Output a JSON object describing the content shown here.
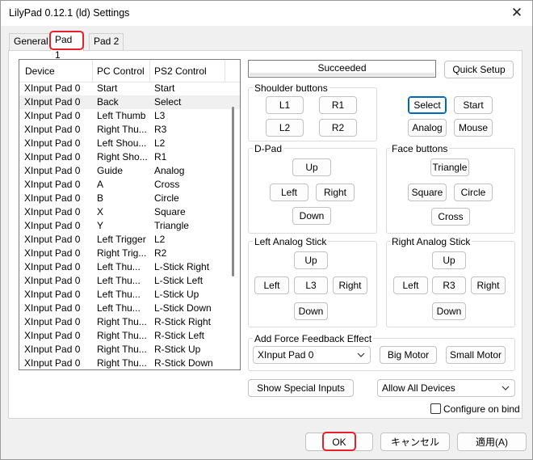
{
  "window": {
    "title": "LilyPad 0.12.1 (ld) Settings",
    "close_glyph": "✕"
  },
  "tabs": [
    {
      "label": "General"
    },
    {
      "label": "Pad 1"
    },
    {
      "label": "Pad 2"
    }
  ],
  "list": {
    "headers": [
      "Device",
      "PC Control",
      "PS2 Control"
    ],
    "rows": [
      [
        "XInput Pad 0",
        "Start",
        "Start"
      ],
      [
        "XInput Pad 0",
        "Back",
        "Select"
      ],
      [
        "XInput Pad 0",
        "Left Thumb",
        "L3"
      ],
      [
        "XInput Pad 0",
        "Right Thu...",
        "R3"
      ],
      [
        "XInput Pad 0",
        "Left Shou...",
        "L2"
      ],
      [
        "XInput Pad 0",
        "Right Sho...",
        "R1"
      ],
      [
        "XInput Pad 0",
        "Guide",
        "Analog"
      ],
      [
        "XInput Pad 0",
        "A",
        "Cross"
      ],
      [
        "XInput Pad 0",
        "B",
        "Circle"
      ],
      [
        "XInput Pad 0",
        "X",
        "Square"
      ],
      [
        "XInput Pad 0",
        "Y",
        "Triangle"
      ],
      [
        "XInput Pad 0",
        "Left Trigger",
        "L2"
      ],
      [
        "XInput Pad 0",
        "Right Trig...",
        "R2"
      ],
      [
        "XInput Pad 0",
        "Left Thu...",
        "L-Stick Right"
      ],
      [
        "XInput Pad 0",
        "Left Thu...",
        "L-Stick Left"
      ],
      [
        "XInput Pad 0",
        "Left Thu...",
        "L-Stick Up"
      ],
      [
        "XInput Pad 0",
        "Left Thu...",
        "L-Stick Down"
      ],
      [
        "XInput Pad 0",
        "Right Thu...",
        "R-Stick Right"
      ],
      [
        "XInput Pad 0",
        "Right Thu...",
        "R-Stick Left"
      ],
      [
        "XInput Pad 0",
        "Right Thu...",
        "R-Stick Up"
      ],
      [
        "XInput Pad 0",
        "Right Thu...",
        "R-Stick Down"
      ]
    ]
  },
  "status": {
    "text": "Succeeded"
  },
  "quick_setup": "Quick Setup",
  "shoulder": {
    "label": "Shoulder buttons",
    "l1": "L1",
    "r1": "R1",
    "l2": "L2",
    "r2": "R2"
  },
  "misc": {
    "select": "Select",
    "start": "Start",
    "analog": "Analog",
    "mouse": "Mouse"
  },
  "dpad": {
    "label": "D-Pad",
    "up": "Up",
    "left": "Left",
    "right": "Right",
    "down": "Down"
  },
  "face": {
    "label": "Face buttons",
    "triangle": "Triangle",
    "square": "Square",
    "circle": "Circle",
    "cross": "Cross"
  },
  "left_stick": {
    "label": "Left Analog Stick",
    "up": "Up",
    "left": "Left",
    "center": "L3",
    "right": "Right",
    "down": "Down"
  },
  "right_stick": {
    "label": "Right Analog Stick",
    "up": "Up",
    "left": "Left",
    "center": "R3",
    "right": "Right",
    "down": "Down"
  },
  "force_feedback": {
    "label": "Add Force Feedback Effect",
    "device": "XInput Pad 0",
    "big_motor": "Big Motor",
    "small_motor": "Small Motor"
  },
  "special_inputs": "Show Special Inputs",
  "device_filter": "Allow All Devices",
  "configure_on_bind": "Configure on bind",
  "footer": {
    "ok": "OK",
    "cancel": "キャンセル",
    "apply": "適用(A)"
  },
  "colors": {
    "highlight": "#e8202a",
    "focus": "#0067c0"
  }
}
